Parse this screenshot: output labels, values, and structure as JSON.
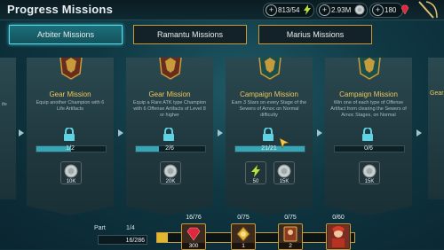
{
  "header": {
    "title": "Progress Missions",
    "resources": [
      {
        "name": "energy",
        "value": "813/54",
        "icon": "lightning-icon",
        "color": "#b6e23a"
      },
      {
        "name": "silver",
        "value": "2.93M",
        "icon": "silver-coin-icon",
        "color": "#cfd6d8"
      },
      {
        "name": "gems",
        "value": "180",
        "icon": "ruby-gem-icon",
        "color": "#e0283c"
      }
    ],
    "close_icon": "close-arrow-icon"
  },
  "tabs": [
    {
      "label": "Arbiter Missions",
      "active": true
    },
    {
      "label": "Ramantu Missions",
      "active": false
    },
    {
      "label": "Marius Missions",
      "active": false
    }
  ],
  "side_text": {
    "left": "ife",
    "right": "Gear"
  },
  "cards": [
    {
      "name": "Gear Mission",
      "description": "Equip another Champion with 6 Life Artifacts",
      "progress_text": "1/2",
      "progress": 0.5,
      "rewards": [
        {
          "icon": "silver-coin-icon",
          "amount": "10K"
        }
      ]
    },
    {
      "name": "Gear Mission",
      "description": "Equip a Rare ATK type Champion with 6 Offense Artifacts of Level 8 or higher",
      "progress_text": "2/6",
      "progress": 0.33,
      "rewards": [
        {
          "icon": "silver-coin-icon",
          "amount": "20K"
        }
      ]
    },
    {
      "name": "Campaign Mission",
      "description": "Earn 3 Stars on every Stage of the Sewers of Arnoc on Normal difficulty",
      "progress_text": "21/21",
      "progress": 1.0,
      "rewards": [
        {
          "icon": "energy-icon",
          "amount": "50"
        },
        {
          "icon": "silver-coin-icon",
          "amount": "15K"
        }
      ]
    },
    {
      "name": "Campaign Mission",
      "description": "Win one of each type of Offense Artifact from clearing the Sewers of Arnoc Stages, on Normal",
      "progress_text": "0/6",
      "progress": 0.0,
      "rewards": [
        {
          "icon": "silver-coin-icon",
          "amount": "15K"
        }
      ]
    }
  ],
  "bottom": {
    "part_label": "Part",
    "part_value": "1/4",
    "points_value": "16/286",
    "progress": 0.055,
    "milestones": [
      {
        "threshold": "16/76",
        "icon": "ruby-gem-icon",
        "amount": "300"
      },
      {
        "threshold": "0/75",
        "icon": "golden-relic-icon",
        "amount": "1"
      },
      {
        "threshold": "0/75",
        "icon": "champion-card-icon",
        "amount": "2"
      },
      {
        "threshold": "0/60",
        "icon": "champion-portrait-icon",
        "amount": ""
      }
    ]
  }
}
